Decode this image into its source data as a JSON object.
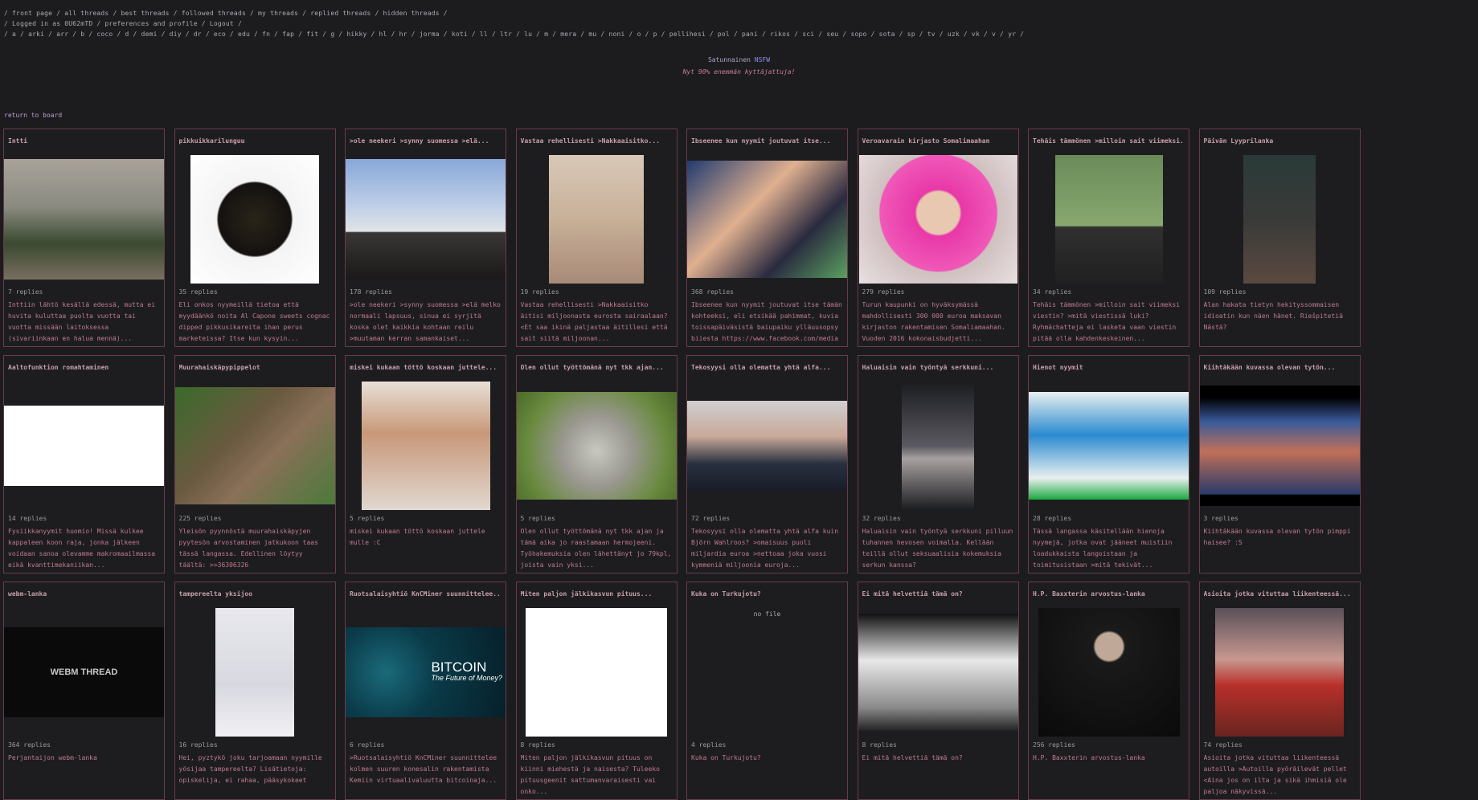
{
  "nav": {
    "line1": "/ front page / all threads / best threads / followed threads / my threads / replied threads / hidden threads /",
    "line2": "/ Logged in as 0U62mTD / preferences and profile / Logout /",
    "line3": "/ a / arki / arr / b / coco / d / demi / diy / dr / eco / edu / fn / fap / fit / g / hikky / hl / hr / jorma / koti / ll / ltr / lu / m / mera / mu / noni / o / p / pellihesi / pol / pani / rikos / sci / seu / sopo / sota / sp / tv / uzk / vk / v / yr /"
  },
  "board": {
    "title_prefix": "Satunnainen ",
    "title_nsfw": "NSFW",
    "subtitle": "Nyt 90% enemmän kyttäjattuja!"
  },
  "return_link": "return to board",
  "threads": [
    {
      "title": "Intti",
      "img": "img-photo1",
      "w": 201,
      "h": 150,
      "replies": "7 replies",
      "excerpt": "Inttiin lähtö kesällä edessä, mutta ei huvita kuluttaa puolta vuotta tai vuotta missään laitoksessa (sivariinkaan en halua mennä)..."
    },
    {
      "title": "pikkuikkarilunguu",
      "img": "img-box",
      "w": 160,
      "h": 160,
      "replies": "35 replies",
      "excerpt": "Eli onkos nyymeillä tietoa että myydäänkö noita Al Capone sweets cognac dipped pikkusikareita ihan perus marketeissa? Itse kun kysyin..."
    },
    {
      "title": ">ole neekeri >synny suomessa >elä...",
      "img": "img-street",
      "w": 201,
      "h": 150,
      "replies": "178 replies",
      "excerpt": ">ole neekeri >synny suomessa >elä melko normaali lapsuus, sinua ei syrjitä koska olet kaikkia kohtaan reilu >muutaman kerran samankaiset..."
    },
    {
      "title": "Vastaa rehellisesti >Nakkaaisitko...",
      "img": "img-beach",
      "w": 118,
      "h": 160,
      "replies": "19 replies",
      "excerpt": "Vastaa rehellisesti >Nakkaaisitko äitisi miljoonasta eurosta sairaalaan? <Et saa ikinä paljastaa äitillesi että sait siitä miljoonan..."
    },
    {
      "title": "Ibseenee kun nyymit joutuvat itse...",
      "img": "img-party",
      "w": 201,
      "h": 146,
      "replies": "368 replies",
      "excerpt": "Ibseenee kun nyymit joutuvat itse tämän kohteeksi, eli etsikää pahimmat, kuvia toissapäiväsistä baiupaiku ylläuusopsy biiesta https://www.facebook.com/media"
    },
    {
      "title": "Veroavarain kirjasto Somalimaahan",
      "img": "img-pink",
      "w": 197,
      "h": 160,
      "replies": "279 replies",
      "excerpt": "Turun kaupunki on hyväksymässä mahdollisesti 300 000 euroa maksavan kirjaston rakentamisen Somaliamaahan. Vuoden 2016 kokonaisbudjetti..."
    },
    {
      "title": "Tehäis tämmönen >milloin sait viimeksi...",
      "img": "img-screen",
      "w": 134,
      "h": 160,
      "replies": "34 replies",
      "excerpt": "Tehäis tämmönen >milloin sait viimeksi viestin? >mitä viestissä luki? Ryhmächatteja ei lasketa vaan viestin pitää olla kahdenkeskeinen..."
    },
    {
      "title": "Päivän Lyyprilanka",
      "img": "img-dark",
      "w": 90,
      "h": 160,
      "replies": "109 replies",
      "excerpt": "Alan hakata tietyn hekityssommaisen idioatin kun näen hänet. Riešpitetiä Nästä?"
    },
    {
      "title": "Aaltofunktion romahtaminen",
      "img": "img-diagram",
      "w": 201,
      "h": 100,
      "replies": "14 replies",
      "excerpt": "Fysiikkanyymit huomio! Missä kulkee kappaleen koon raja, jonka jälkeen voidaan sanoa olevamme makromaailmassa eikä kvanttimekaniikan..."
    },
    {
      "title": "Muurahaiskäpypippelot",
      "img": "img-pangolin",
      "w": 201,
      "h": 146,
      "replies": "225 replies",
      "excerpt": "Yleisön pyynnöstä muurahaiskäpyjen pyytesön arvostaminen jatkukoon taas tässä langassa. Edellinen löytyy täältä: >>36306326"
    },
    {
      "title": "miskei kukaan töttö koskaan juttele...",
      "img": "img-woman2",
      "w": 160,
      "h": 160,
      "replies": "5 replies",
      "excerpt": "miskei kukaan töttö koskaan juttele mulle :C"
    },
    {
      "title": "Olen ollut työttömänä nyt tkk ajan...",
      "img": "img-cat",
      "w": 201,
      "h": 134,
      "replies": "5 replies",
      "excerpt": "Olen ollut työttömänä nyt tkk ajan ja tämä aika jo raastamaan hermojeeni. Työhakemuksia olen lähettänyt jo 79kpl, joista vain yksi..."
    },
    {
      "title": "Tekosyysi olla olematta yhtä alfa...",
      "img": "img-oldman",
      "w": 201,
      "h": 112,
      "replies": "72 replies",
      "excerpt": "Tekosyysi olla olematta yhtä alfa kuin Björn Wahlroos? >omaisuus puoli miljardia euroa >nettoaa joka vuosi kymmeniä miljoonia euroja..."
    },
    {
      "title": "Haluaisin vain työntyä serkkuni...",
      "img": "img-legs",
      "w": 90,
      "h": 160,
      "replies": "32 replies",
      "excerpt": "Haluaisin vain työntyä serkkuni pilluun tuhannen hevosen voimalla. Kellään teillä ollut seksuaalisia kokemuksia serkun kanssa?"
    },
    {
      "title": "Hienot nyymit",
      "img": "img-twister",
      "w": 201,
      "h": 134,
      "replies": "28 replies",
      "excerpt": "Tässä langassa käsitellään hienoja nyymejä, jotka ovat jääneet muistiin loadukkaista langoistaan ja toimitusistaan >mitä tekivät..."
    },
    {
      "title": "Kiihtäkään kuvassa olevan tytön...",
      "img": "img-red",
      "w": 201,
      "h": 150,
      "replies": "3 replies",
      "excerpt": "Kiihtäkään kuvassa olevan tytön pimppi haisee? :S"
    },
    {
      "title": "webm-lanka",
      "img": "img-webm",
      "w": 201,
      "h": 112,
      "text": "WEBM THREAD",
      "replies": "364 replies",
      "excerpt": "Perjantaijon webm-lanka"
    },
    {
      "title": "tampereelta yksijoo",
      "img": "img-snow",
      "w": 98,
      "h": 160,
      "replies": "16 replies",
      "excerpt": "Hei, pyztykö joku tarjoamaan nyymille yösijaa tampereelta? Lisätietoja: opiskelija, ei rahaa, pääsykokeet"
    },
    {
      "title": "Ruotsalaisyhtiö KnCMiner suunnittelee...",
      "img": "img-bitcoin",
      "w": 201,
      "h": 112,
      "text": "BITCOIN",
      "text2": "The Future of Money?",
      "replies": "6 replies",
      "excerpt": ">Ruotsalaisyhtiö KnCMiner suunnittelee kolmen suuren konesalin rakentamista Kemiin virtuaalivaluutta bitcoinaja..."
    },
    {
      "title": "Miten paljon jälkikasvun pituus...",
      "img": "img-wojak",
      "w": 176,
      "h": 160,
      "replies": "8 replies",
      "excerpt": "Miten paljon jälkikasvun pituus on kiinni miehestä ja naisesta? Tuleeko pituusgeenit sattumanvaraisesti vai onko..."
    },
    {
      "title": "Kuka on Turkujotu?",
      "img": "",
      "w": 0,
      "h": 0,
      "nofile": "no file",
      "replies": "4 replies",
      "excerpt": "Kuka on Turkujotu?"
    },
    {
      "title": "Ei mitä helvettiä tämä on?",
      "img": "img-skullface",
      "w": 201,
      "h": 146,
      "replies": "8 replies",
      "excerpt": "Ei mitä helvettiä tämä on?"
    },
    {
      "title": "H.P. Baxxterin arvostus-lanka",
      "img": "img-jacket",
      "w": 176,
      "h": 160,
      "replies": "256 replies",
      "excerpt": "H.P. Baxxterin arvostus-lanka"
    },
    {
      "title": "Asioita jotka vituttaa liikenteessä...",
      "img": "img-picard",
      "w": 160,
      "h": 160,
      "replies": "74 replies",
      "excerpt": "Asioita jotka vituttaa liikenteessä autoilla >Autoilla pyöräilevät pellet <Aina jos on ilta ja sikä ihmisiä ole paljoa näkyvissä..."
    }
  ]
}
